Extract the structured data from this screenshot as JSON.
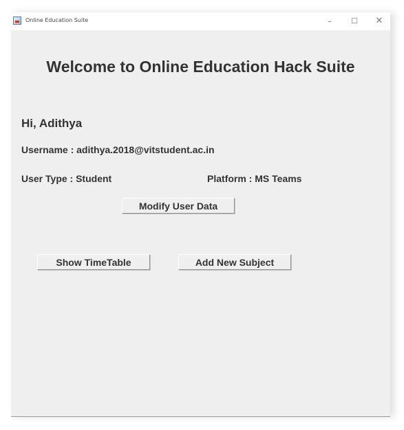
{
  "window": {
    "title": "Online Education Suite",
    "controls": {
      "minimize": "–",
      "maximize": "☐",
      "close": "✕"
    }
  },
  "main": {
    "heading": "Welcome to Online Education Hack Suite",
    "greeting": "Hi, Adithya",
    "username": "Username : adithya.2018@vitstudent.ac.in",
    "user_type": "User Type : Student",
    "platform": "Platform : MS Teams"
  },
  "buttons": {
    "modify_user_data": "Modify User Data",
    "show_timetable": "Show TimeTable",
    "add_new_subject": "Add New Subject"
  },
  "icons": {
    "app_icon": "java-app-icon"
  }
}
